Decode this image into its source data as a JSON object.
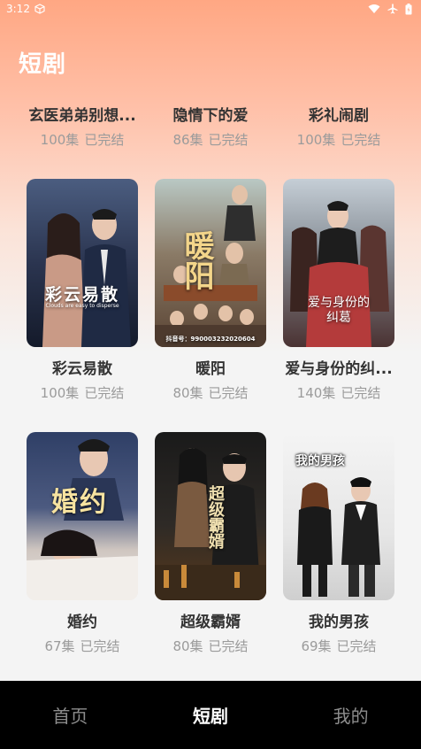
{
  "status": {
    "time": "3:12"
  },
  "page": {
    "title": "短剧"
  },
  "top_row": [
    {
      "title": "玄医弟弟别想...",
      "episodes": "100集",
      "status": "已完结"
    },
    {
      "title": "隐情下的爱",
      "episodes": "86集",
      "status": "已完结"
    },
    {
      "title": "彩礼闹剧",
      "episodes": "100集",
      "status": "已完结"
    }
  ],
  "rows": [
    [
      {
        "title": "彩云易散",
        "episodes": "100集",
        "status": "已完结",
        "poster_text": "彩云易散",
        "poster_subtext": "Clouds are easy to disperse",
        "colors": [
          "#3a4a6b",
          "#1c2438"
        ]
      },
      {
        "title": "暖阳",
        "episodes": "80集",
        "status": "已完结",
        "poster_text": "暖阳",
        "poster_subtext": "抖音号：990003232020604",
        "colors": [
          "#c9b79a",
          "#6b5a48"
        ]
      },
      {
        "title": "爱与身份的纠...",
        "episodes": "140集",
        "status": "已完结",
        "poster_text": "爱与身份的纠葛",
        "colors": [
          "#9aa3ad",
          "#3b2e2e"
        ]
      }
    ],
    [
      {
        "title": "婚约",
        "episodes": "67集",
        "status": "已完结",
        "poster_text": "婚约",
        "colors": [
          "#3d4f7a",
          "#d9cfc8"
        ]
      },
      {
        "title": "超级霸婿",
        "episodes": "80集",
        "status": "已完结",
        "poster_text": "超级霸婿",
        "colors": [
          "#2b2b2b",
          "#6a4a2a"
        ]
      },
      {
        "title": "我的男孩",
        "episodes": "69集",
        "status": "已完结",
        "poster_text": "我的男孩",
        "colors": [
          "#f0f0f0",
          "#2a2a2a"
        ]
      }
    ]
  ],
  "tabbar": {
    "home": "首页",
    "drama": "短剧",
    "mine": "我的",
    "active": "drama"
  }
}
